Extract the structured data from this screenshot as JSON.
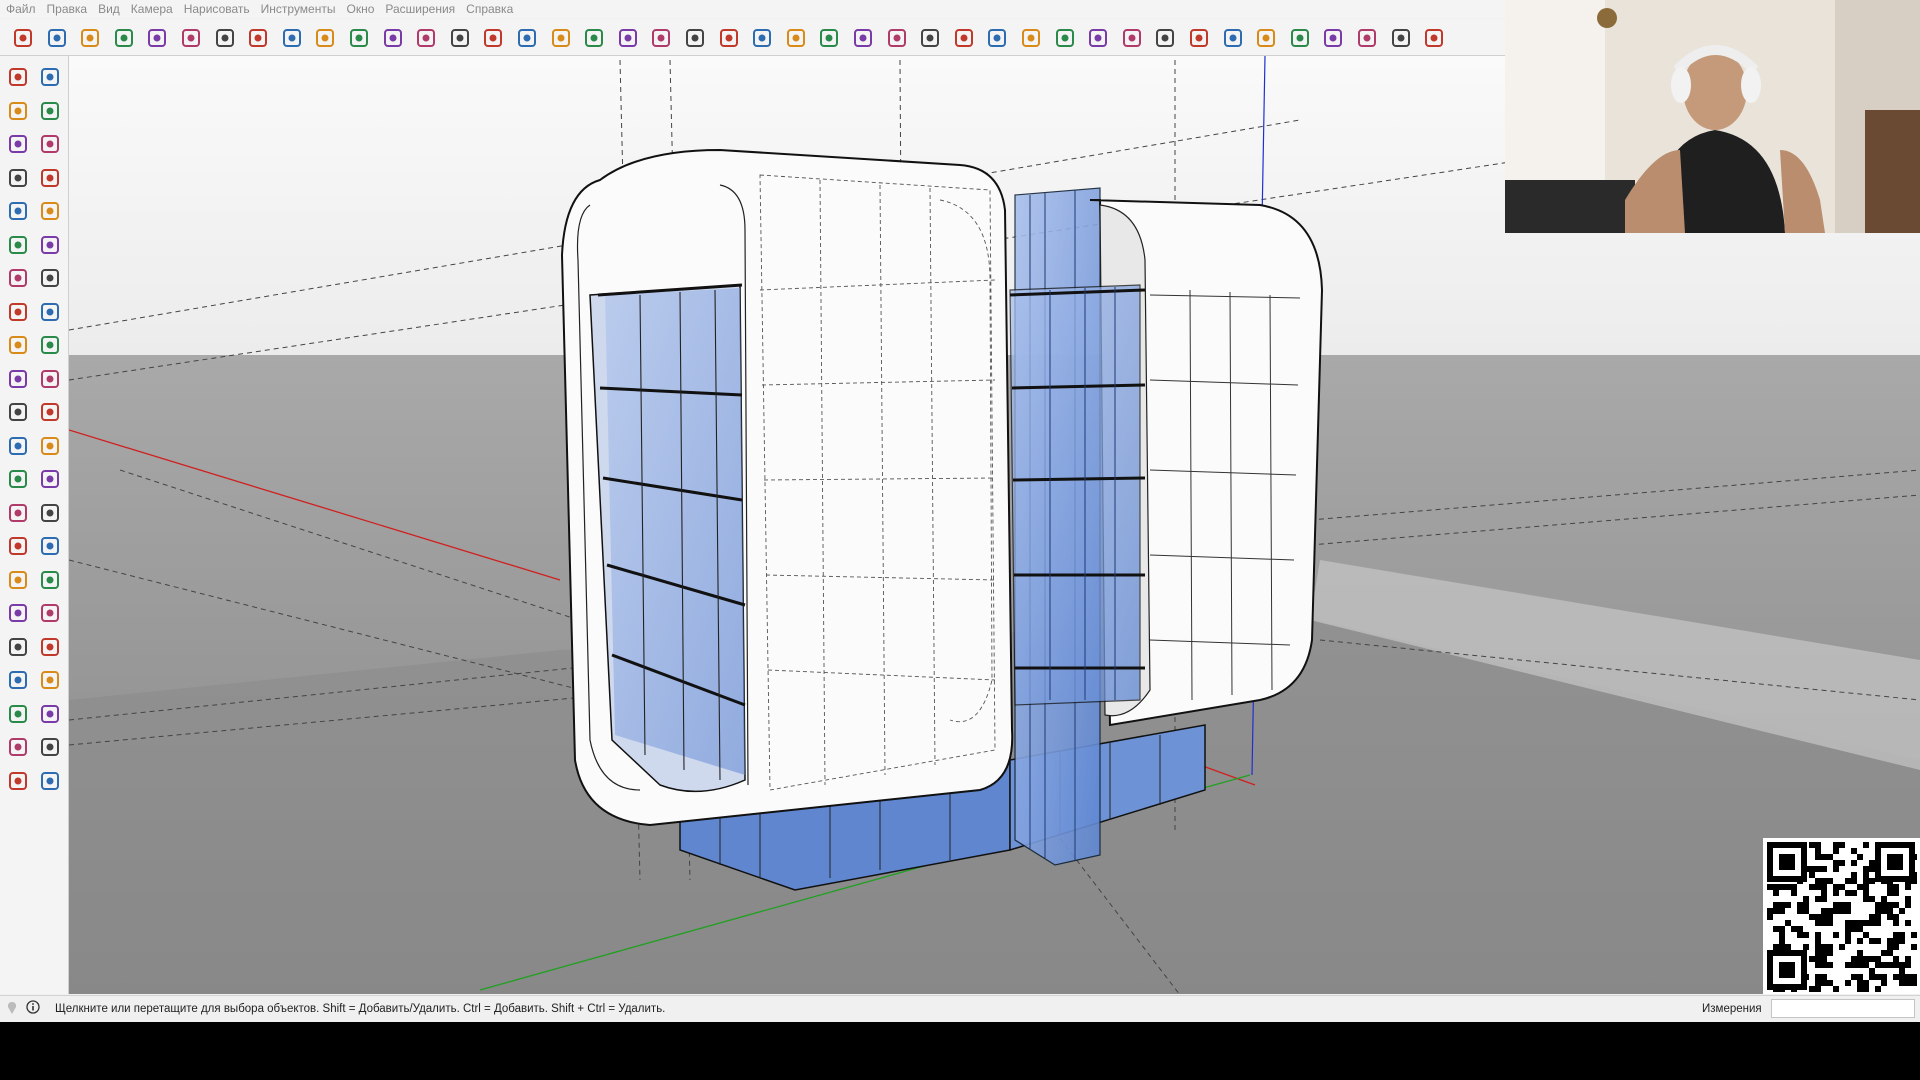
{
  "menu": [
    "Файл",
    "Правка",
    "Вид",
    "Камера",
    "Нарисовать",
    "Инструменты",
    "Окно",
    "Расширения",
    "Справка"
  ],
  "toolbar_icons": [
    "search-icon",
    "select-arrow-icon",
    "eraser-icon",
    "pencil-line-icon",
    "freehand-icon",
    "rectangle-icon",
    "push-pull-icon",
    "follow-me-icon",
    "move-icon",
    "rotate-icon",
    "scale-icon",
    "offset-icon",
    "tape-measure-icon",
    "paint-bucket-icon",
    "orbit-icon",
    "pan-icon",
    "zoom-icon",
    "zoom-extents-icon",
    "components-icon",
    "layers-icon",
    "styles-icon",
    "scenes-icon",
    "account-icon",
    "xray-icon",
    "back-edges-icon",
    "wireframe-icon",
    "hidden-line-icon",
    "shaded-icon",
    "textured-icon",
    "section-plane-icon",
    "section-fill-icon",
    "iso-view-icon",
    "top-view-icon",
    "front-view-icon",
    "right-view-icon",
    "back-view-icon",
    "left-view-icon",
    "sandbox-from-contours-icon",
    "sandbox-from-scratch-icon",
    "smoove-icon",
    "stamp-icon",
    "drape-icon",
    "add-detail-icon"
  ],
  "left_tools": [
    [
      "select-icon",
      "orbit-icon"
    ],
    [
      "paint-bucket-icon",
      "eraser-icon"
    ],
    [
      "make-component-icon",
      "tape-measure-icon"
    ],
    [
      "line-icon",
      "freehand-icon"
    ],
    [
      "rectangle-icon",
      "rotated-rectangle-icon"
    ],
    [
      "circle-icon",
      "polygon-icon"
    ],
    [
      "arc-icon",
      "two-point-arc-icon"
    ],
    [
      "three-point-arc-icon",
      "pie-icon"
    ],
    [
      "move-icon",
      "push-pull-icon"
    ],
    [
      "rotate-icon",
      "follow-me-icon"
    ],
    [
      "scale-icon",
      "offset-icon"
    ],
    [
      "axes-icon",
      "3d-text-icon"
    ],
    [
      "tape-measure-icon",
      "dimension-icon"
    ],
    [
      "protractor-icon",
      "text-icon"
    ],
    [
      "position-camera-icon",
      "section-plane-icon"
    ],
    [
      "orbit-icon",
      "pan-icon"
    ],
    [
      "zoom-icon",
      "zoom-window-icon"
    ],
    [
      "zoom-extents-icon",
      "previous-view-icon"
    ],
    [
      "walk-icon",
      "footprints-icon"
    ],
    [
      "look-around-icon",
      "audio-icon"
    ],
    [
      "components-icon",
      "styles-icon"
    ],
    [
      "layers-icon",
      "scenes-icon"
    ]
  ],
  "status": {
    "hint": "Щелкните или перетащите для выбора объектов. Shift = Добавить/Удалить. Ctrl = Добавить. Shift + Ctrl = Удалить.",
    "measurements_label": "Измерения",
    "measurements_value": ""
  },
  "colors": {
    "x_axis": "#d02020",
    "y_axis": "#20a020",
    "z_axis": "#2030d0",
    "glass": "#4f7fd1",
    "sky": "#f5f5f5",
    "ground": "#8f8f8f"
  }
}
